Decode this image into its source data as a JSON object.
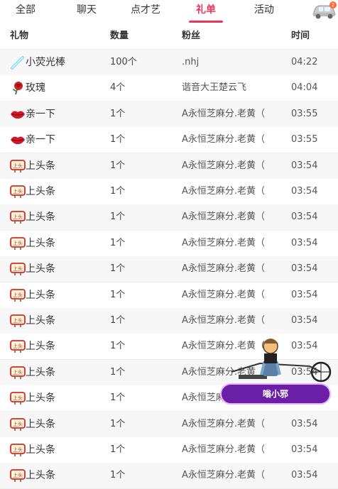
{
  "tabs": [
    {
      "label": "全部",
      "active": false
    },
    {
      "label": "聊天",
      "active": false
    },
    {
      "label": "点才艺",
      "active": false
    },
    {
      "label": "礼单",
      "active": true
    },
    {
      "label": "活动",
      "active": false
    }
  ],
  "car_badge": "2",
  "columns": {
    "gift": "礼物",
    "qty": "数量",
    "fan": "粉丝",
    "time": "时间"
  },
  "rows": [
    {
      "gift": "小荧光棒",
      "icon": "glowstick-icon",
      "qty": "100个",
      "fan": ".nhj",
      "time": "04:22"
    },
    {
      "gift": "玫瑰",
      "icon": "rose-icon",
      "qty": "4个",
      "fan": "谐音大王楚云飞",
      "time": "04:04"
    },
    {
      "gift": "亲一下",
      "icon": "lips-icon",
      "qty": "1个",
      "fan": "A永恒芝麻分.老黄（",
      "time": "03:55"
    },
    {
      "gift": "亲一下",
      "icon": "lips-icon",
      "qty": "1个",
      "fan": "A永恒芝麻分.老黄（",
      "time": "03:55"
    },
    {
      "gift": "上头条",
      "icon": "headline-sign-icon",
      "qty": "1个",
      "fan": "A永恒芝麻分.老黄（",
      "time": "03:54"
    },
    {
      "gift": "上头条",
      "icon": "headline-sign-icon",
      "qty": "1个",
      "fan": "A永恒芝麻分.老黄（",
      "time": "03:54"
    },
    {
      "gift": "上头条",
      "icon": "headline-sign-icon",
      "qty": "1个",
      "fan": "A永恒芝麻分.老黄（",
      "time": "03:54"
    },
    {
      "gift": "上头条",
      "icon": "headline-sign-icon",
      "qty": "1个",
      "fan": "A永恒芝麻分.老黄（",
      "time": "03:54"
    },
    {
      "gift": "上头条",
      "icon": "headline-sign-icon",
      "qty": "1个",
      "fan": "A永恒芝麻分.老黄（",
      "time": "03:54"
    },
    {
      "gift": "上头条",
      "icon": "headline-sign-icon",
      "qty": "1个",
      "fan": "A永恒芝麻分.老黄（",
      "time": "03:54"
    },
    {
      "gift": "上头条",
      "icon": "headline-sign-icon",
      "qty": "1个",
      "fan": "A永恒芝麻分.老黄（",
      "time": "03:54"
    },
    {
      "gift": "上头条",
      "icon": "headline-sign-icon",
      "qty": "1个",
      "fan": "A永恒芝麻分.老黄（",
      "time": "03:54"
    },
    {
      "gift": "上头条",
      "icon": "headline-sign-icon",
      "qty": "1个",
      "fan": "A永恒芝麻分.老黄（",
      "time": "03:54"
    },
    {
      "gift": "上头条",
      "icon": "headline-sign-icon",
      "qty": "1个",
      "fan": "A永恒芝麻分.老黄（",
      "time": "03:54"
    },
    {
      "gift": "上头条",
      "icon": "headline-sign-icon",
      "qty": "1个",
      "fan": "A永恒芝麻分.老黄（",
      "time": "03:54"
    },
    {
      "gift": "上头条",
      "icon": "headline-sign-icon",
      "qty": "1个",
      "fan": "A永恒芝麻分.老黄（",
      "time": "03:54"
    },
    {
      "gift": "上头条",
      "icon": "headline-sign-icon",
      "qty": "1个",
      "fan": "A永恒芝麻分.老黄（",
      "time": "03:54"
    }
  ],
  "overlay": {
    "name": "嗡小邪"
  },
  "colors": {
    "accent": "#e8365d",
    "banner": "#6a1fa6"
  }
}
